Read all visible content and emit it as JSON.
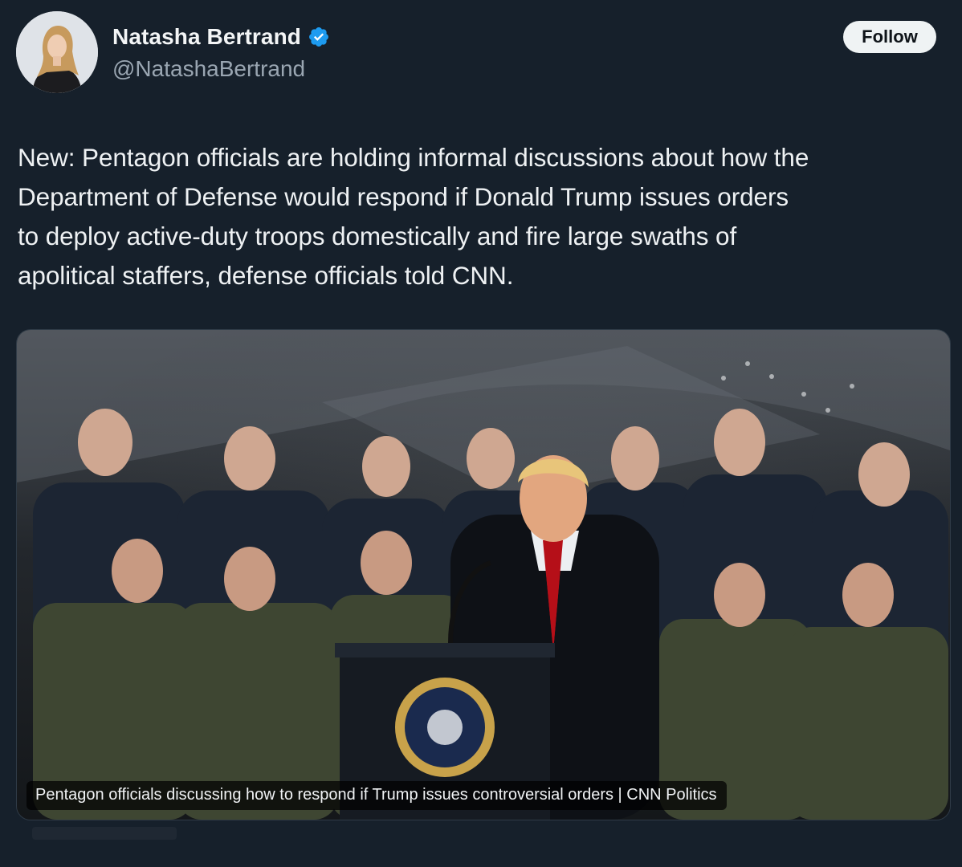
{
  "author": {
    "display_name": "Natasha Bertrand",
    "handle": "@NatashaBertrand",
    "verified": true,
    "avatar_icon": "profile-photo-icon"
  },
  "actions": {
    "follow_label": "Follow"
  },
  "tweet": {
    "lines": [
      "New: Pentagon officials are holding informal discussions about how the",
      "Department of Defense would respond if Donald Trump issues orders",
      "to deploy active-duty troops domestically and fire large swaths of",
      "apolitical staffers, defense officials told CNN."
    ]
  },
  "link_card": {
    "caption": "Pentagon officials discussing how to respond if Trump issues controversial orders | CNN Politics",
    "image_icon": "news-photo-icon"
  },
  "colors": {
    "background": "#16202b",
    "verified_badge": "#1d9bf0",
    "follow_bg": "#eff3f4",
    "handle": "#9aa6b2"
  }
}
